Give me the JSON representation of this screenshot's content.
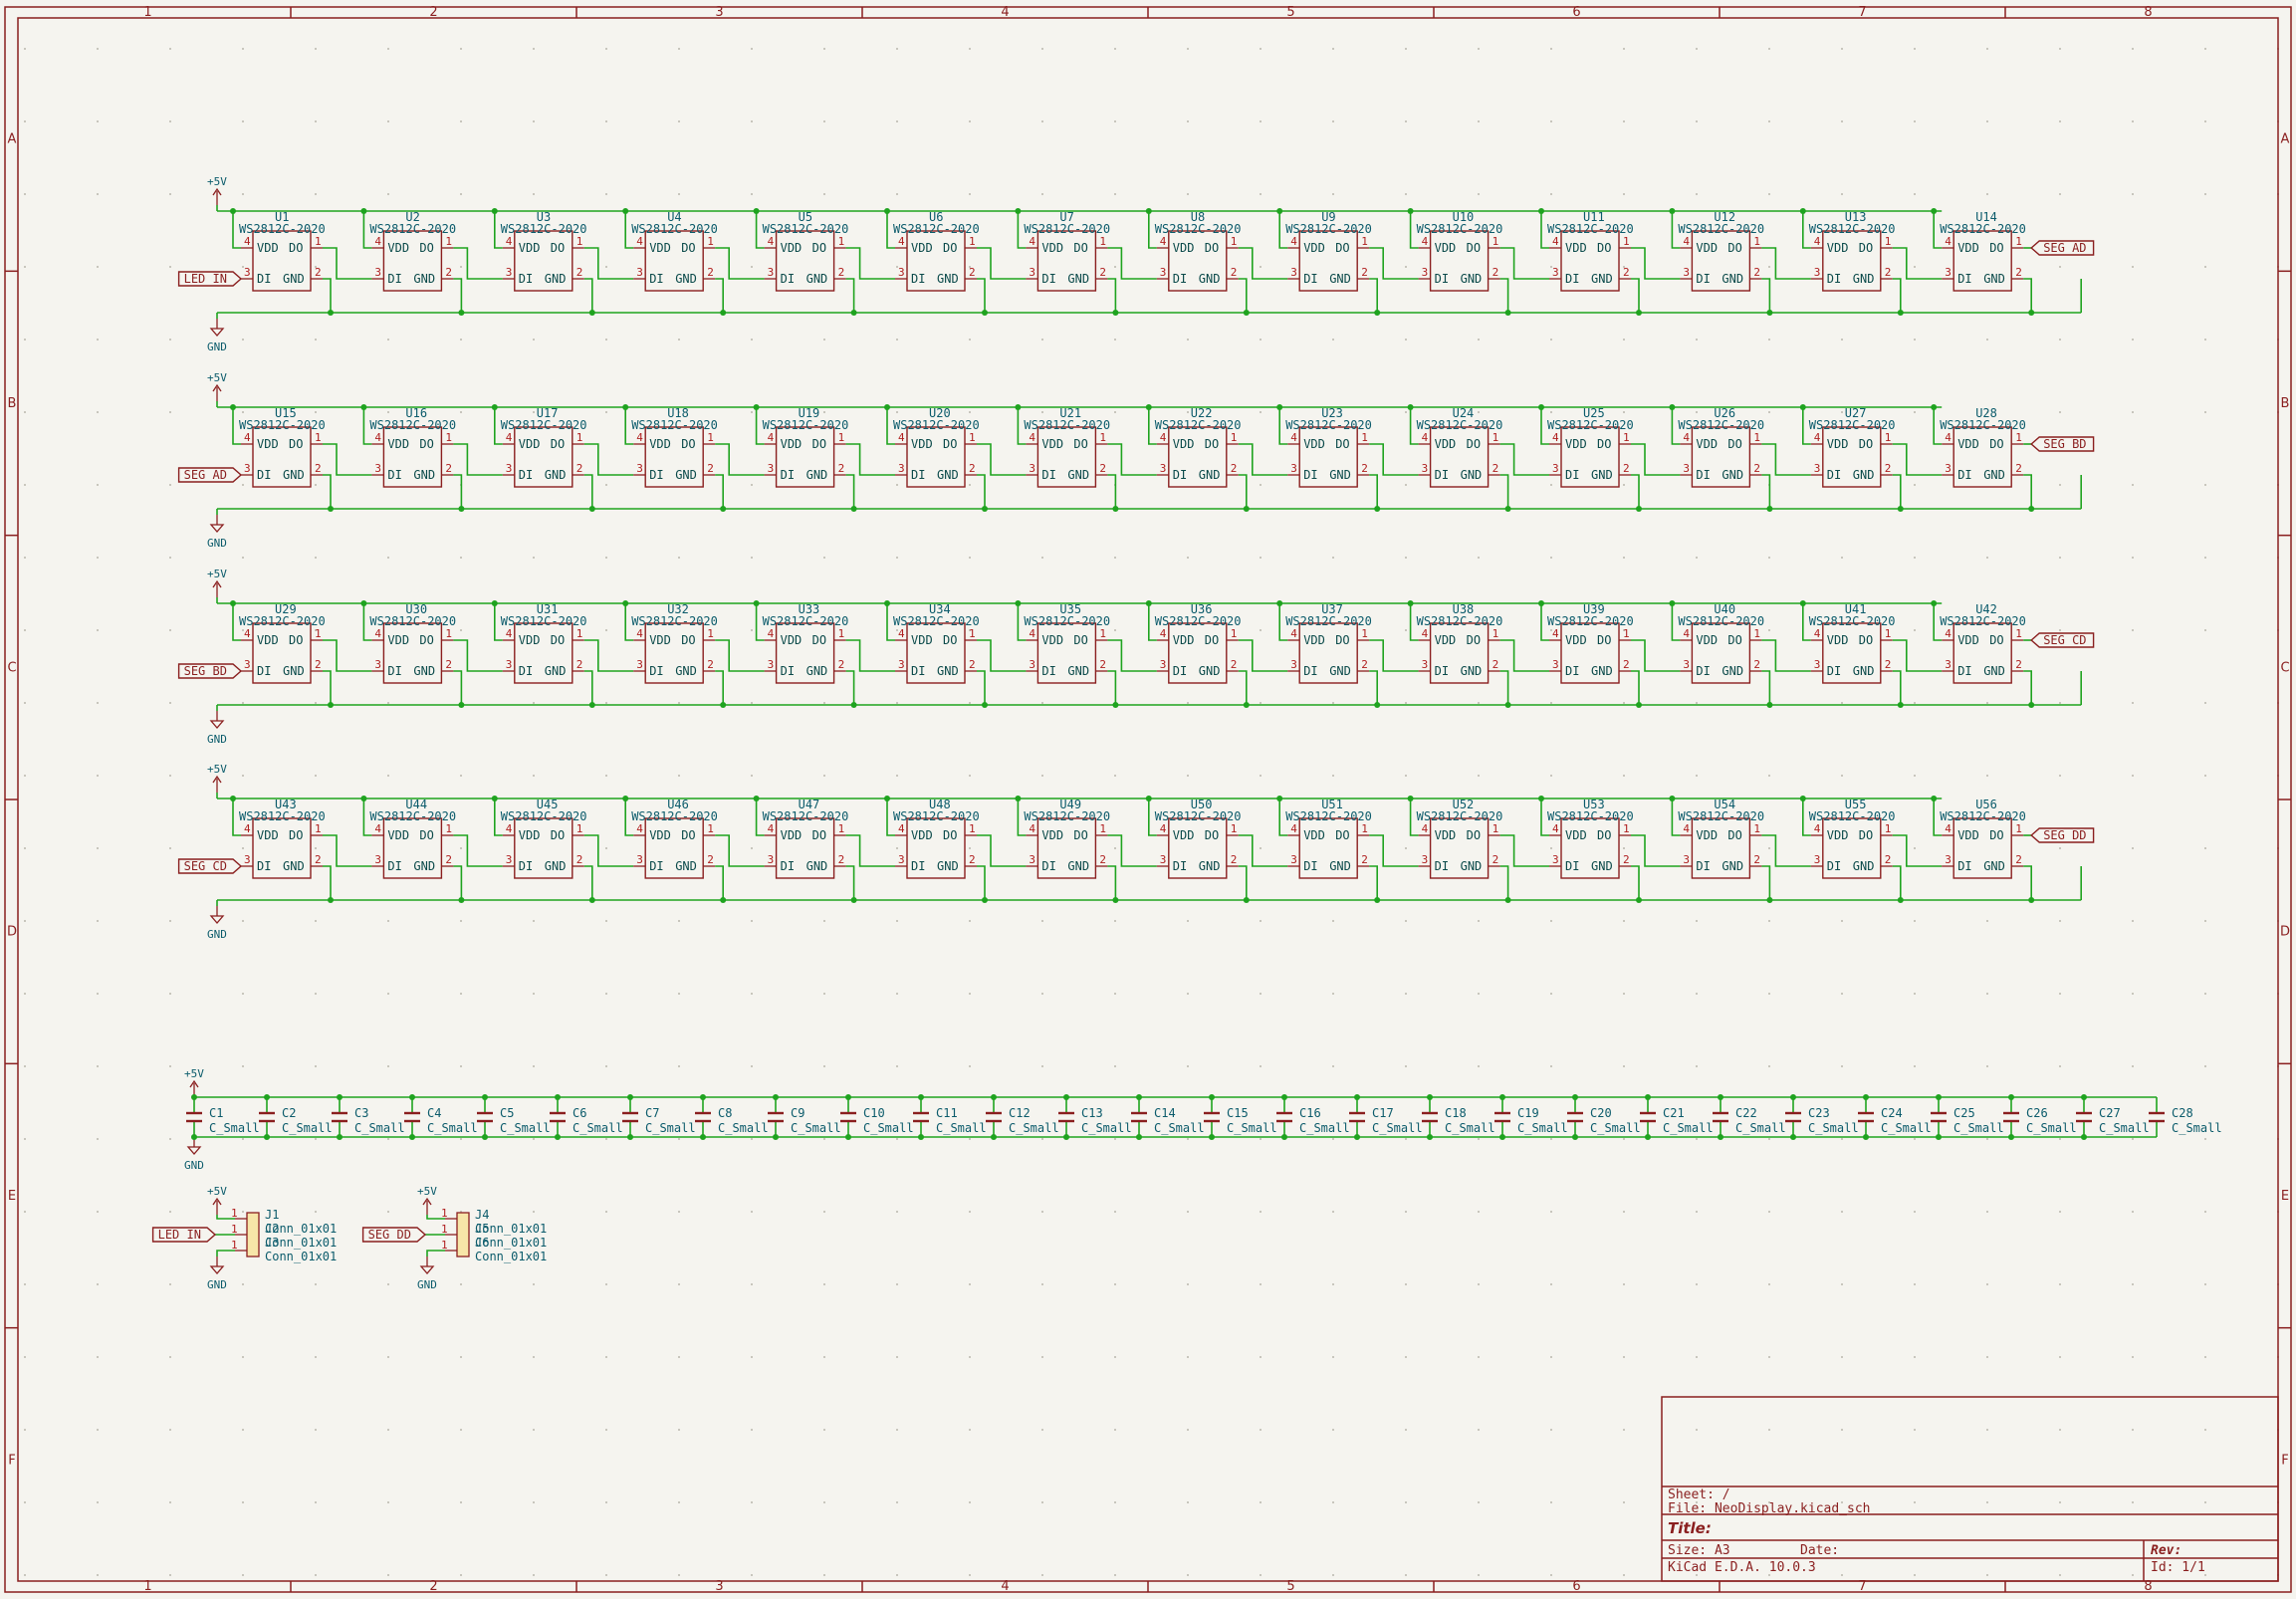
{
  "frame": {
    "columns": [
      "1",
      "2",
      "3",
      "4",
      "5",
      "6",
      "7",
      "8"
    ],
    "rows": [
      "A",
      "B",
      "C",
      "D",
      "E",
      "F"
    ]
  },
  "led_chain": {
    "value": "WS2812C-2020",
    "pin_labels": {
      "vdd": "VDD",
      "do": "DO",
      "di": "DI",
      "gnd": "GND"
    },
    "pin_numbers": {
      "vdd": "4",
      "do": "1",
      "di": "3",
      "gnd": "2"
    },
    "power_label": "+5V",
    "ground_label": "GND",
    "rows": [
      {
        "refs": [
          "U1",
          "U2",
          "U3",
          "U4",
          "U5",
          "U6",
          "U7",
          "U8",
          "U9",
          "U10",
          "U11",
          "U12",
          "U13",
          "U14"
        ],
        "in_label": "LED_IN",
        "out_label": "SEG_AD"
      },
      {
        "refs": [
          "U15",
          "U16",
          "U17",
          "U18",
          "U19",
          "U20",
          "U21",
          "U22",
          "U23",
          "U24",
          "U25",
          "U26",
          "U27",
          "U28"
        ],
        "in_label": "SEG_AD",
        "out_label": "SEG_BD"
      },
      {
        "refs": [
          "U29",
          "U30",
          "U31",
          "U32",
          "U33",
          "U34",
          "U35",
          "U36",
          "U37",
          "U38",
          "U39",
          "U40",
          "U41",
          "U42"
        ],
        "in_label": "SEG_BD",
        "out_label": "SEG_CD"
      },
      {
        "refs": [
          "U43",
          "U44",
          "U45",
          "U46",
          "U47",
          "U48",
          "U49",
          "U50",
          "U51",
          "U52",
          "U53",
          "U54",
          "U55",
          "U56"
        ],
        "in_label": "SEG_CD",
        "out_label": "SEG_DD"
      }
    ]
  },
  "decoupling": {
    "value": "C_Small",
    "power_label": "+5V",
    "ground_label": "GND",
    "refs": [
      "C1",
      "C2",
      "C3",
      "C4",
      "C5",
      "C6",
      "C7",
      "C8",
      "C9",
      "C10",
      "C11",
      "C12",
      "C13",
      "C14",
      "C15",
      "C16",
      "C17",
      "C18",
      "C19",
      "C20",
      "C21",
      "C22",
      "C23",
      "C24",
      "C25",
      "C26",
      "C27",
      "C28"
    ]
  },
  "connectors": [
    {
      "ref": "J1",
      "pin_refs": [
        "J2",
        "J3"
      ],
      "value": "Conn_01x01",
      "label": "LED_IN",
      "power_label": "+5V",
      "ground_label": "GND",
      "pin_number": "1"
    },
    {
      "ref": "J4",
      "pin_refs": [
        "J5",
        "J6"
      ],
      "value": "Conn_01x01",
      "label": "SEG_DD",
      "power_label": "+5V",
      "ground_label": "GND",
      "pin_number": "1"
    }
  ],
  "title_block": {
    "sheet": "Sheet: /",
    "file": "File: NeoDisplay.kicad_sch",
    "title": "Title:",
    "size": "Size: A3",
    "date": "Date:",
    "rev": "Rev:",
    "tool": "KiCad E.D.A. 10.0.3",
    "id": "Id: 1/1"
  }
}
